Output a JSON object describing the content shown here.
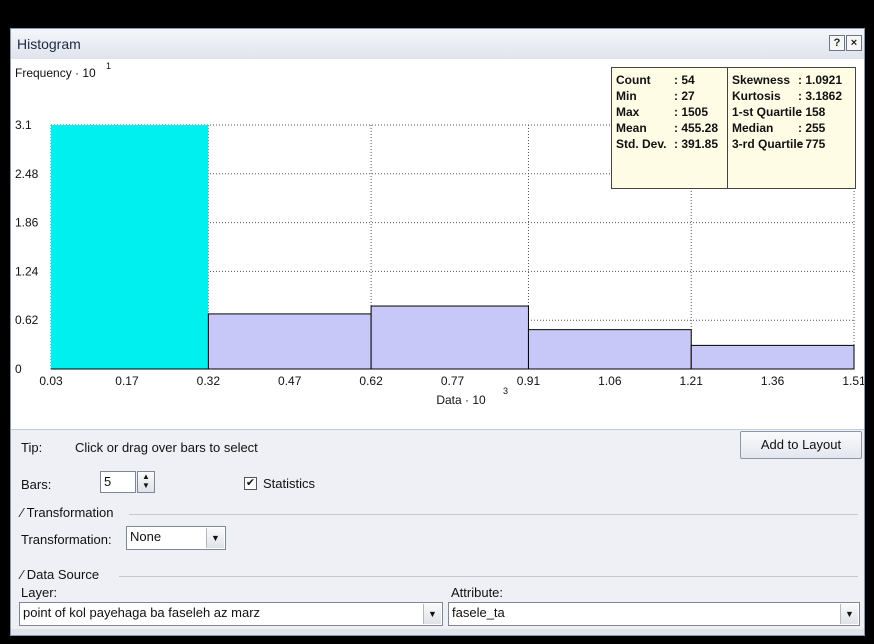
{
  "window": {
    "title": "Histogram",
    "help_label": "?",
    "close_label": "×"
  },
  "chart_data": {
    "type": "bar",
    "ylabel": "Frequency · 10",
    "ylabel_exp": "1",
    "xlabel": "Data · 10",
    "xlabel_exp": "3",
    "yticks": [
      "0",
      "0.62",
      "1.24",
      "1.86",
      "2.48",
      "3.1"
    ],
    "ylim": [
      0,
      3.1
    ],
    "xticks": [
      "0.03",
      "0.17",
      "0.32",
      "0.47",
      "0.62",
      "0.77",
      "0.91",
      "1.06",
      "1.21",
      "1.36",
      "1.51"
    ],
    "xlim": [
      0.03,
      1.51
    ],
    "bins": [
      {
        "x0": 0.03,
        "x1": 0.32,
        "value": 3.1,
        "selected": true
      },
      {
        "x0": 0.32,
        "x1": 0.62,
        "value": 0.7,
        "selected": false
      },
      {
        "x0": 0.62,
        "x1": 0.91,
        "value": 0.8,
        "selected": false
      },
      {
        "x0": 0.91,
        "x1": 1.21,
        "value": 0.5,
        "selected": false
      },
      {
        "x0": 1.21,
        "x1": 1.51,
        "value": 0.3,
        "selected": false
      }
    ],
    "grid": true,
    "colors": {
      "selected": "#00f0f0",
      "unselected": "#c8c8f8",
      "edge": "#000000"
    }
  },
  "stats": {
    "left": [
      {
        "key": "Count",
        "value": ": 54"
      },
      {
        "key": "Min",
        "value": ": 27"
      },
      {
        "key": "Max",
        "value": ": 1505"
      },
      {
        "key": "Mean",
        "value": ": 455.28"
      },
      {
        "key": "Std. Dev.",
        "value": ": 391.85"
      }
    ],
    "right": [
      {
        "key": "Skewness",
        "value": ": 1.0921"
      },
      {
        "key": "Kurtosis",
        "value": ": 3.1862"
      },
      {
        "key": "1-st Quartile",
        "value": ": 158"
      },
      {
        "key": "Median",
        "value": ": 255"
      },
      {
        "key": "3-rd Quartile",
        "value": ": 775"
      }
    ]
  },
  "controls": {
    "tip_label": "Tip:",
    "tip_text": "Click or drag over bars to select",
    "add_to_layout": "Add to Layout",
    "bars_label": "Bars:",
    "bars_value": "5",
    "statistics_label": "Statistics",
    "statistics_checked": "✔",
    "transformation_group": "Transformation",
    "transformation_label": "Transformation:",
    "transformation_value": "None",
    "data_source_group": "Data Source",
    "layer_label": "Layer:",
    "layer_value": "point of kol payehaga ba faseleh az marz",
    "attribute_label": "Attribute:",
    "attribute_value": "fasele_ta",
    "dropdown_arrow": "▼",
    "spin_up": "▲",
    "spin_down": "▼"
  }
}
